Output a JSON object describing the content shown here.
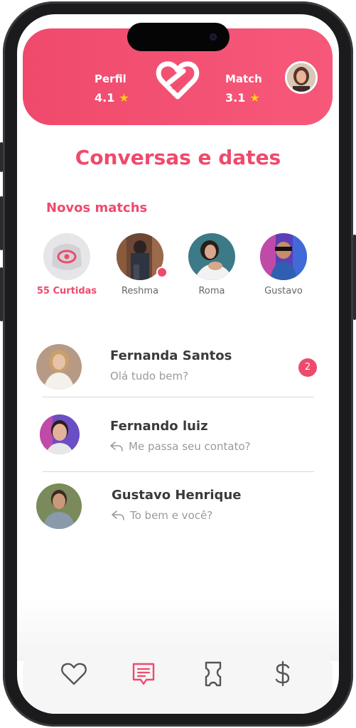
{
  "header": {
    "left_label": "Perfil",
    "left_value": "4.1",
    "right_label": "Match",
    "right_value": "3.1",
    "logo_icon": "heart-link-logo",
    "accent": "#ef4a6c"
  },
  "title": "Conversas e dates",
  "new_matches": {
    "section_label": "Novos matchs",
    "items": [
      {
        "label": "55 Curtidas",
        "icon": "eye-icon"
      },
      {
        "label": "Reshma"
      },
      {
        "label": "Roma"
      },
      {
        "label": "Gustavo"
      }
    ]
  },
  "conversations": [
    {
      "name": "Fernanda Santos",
      "message": "Olá tudo bem?",
      "badge": "2"
    },
    {
      "name": "Fernando luiz",
      "message": "Me passa seu contato?",
      "icon": "reply-icon"
    },
    {
      "name": "Gustavo  Henrique",
      "message": "To bem e você?",
      "icon": "reply-icon"
    }
  ],
  "nav": {
    "items": [
      "heart-icon",
      "chat-icon",
      "ticket-icon",
      "dollar-icon"
    ],
    "active_color": "#ee4a6c",
    "inactive_color": "#555555"
  }
}
